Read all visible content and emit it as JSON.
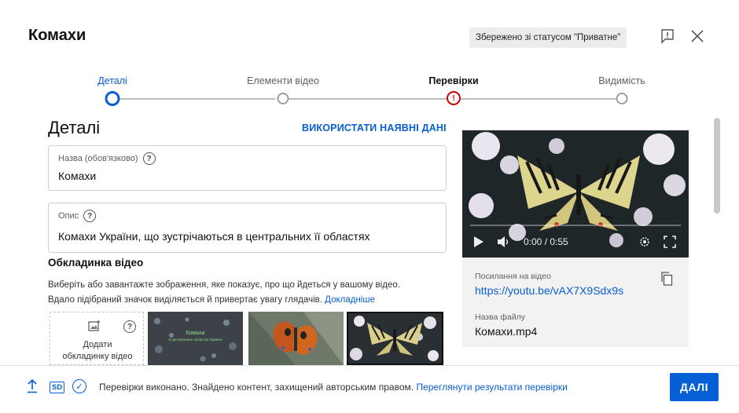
{
  "header": {
    "title": "Комахи",
    "save_status": "Збережено зі статусом \"Приватне\"",
    "feedback_icon": "feedback-icon",
    "close_icon": "close-icon"
  },
  "stepper": {
    "steps": [
      {
        "label": "Деталі",
        "state": "active"
      },
      {
        "label": "Елементи відео",
        "state": "pending"
      },
      {
        "label": "Перевірки",
        "state": "error"
      },
      {
        "label": "Видимість",
        "state": "pending"
      }
    ]
  },
  "details": {
    "heading": "Деталі",
    "reuse_link": "ВИКОРИСТАТИ НАЯВНІ ДАНІ",
    "name_label": "Назва (обов'язково)",
    "name_value": "Комахи",
    "desc_label": "Опис",
    "desc_value": "Комахи України, що зустрічаються в центральних її областях",
    "help_glyph": "?"
  },
  "thumbnail": {
    "heading": "Обкладинка відео",
    "desc_line1": "Виберіть або завантажте зображення, яке показує, про що йдеться у вашому відео.",
    "desc_line2": "Вдало підібраний значок виділяється й привертає увагу глядачів.",
    "learn_more": "Докладніше",
    "upload_label_line1": "Додати",
    "upload_label_line2": "обкладинку відео",
    "thumb1_text_line1": "Комахи",
    "thumb1_text_line2": "в центральних областях України"
  },
  "video": {
    "time": "0:00 / 0:55",
    "link_label": "Посилання на відео",
    "link": "https://youtu.be/vAX7X9Sdx9s",
    "file_label": "Назва файлу",
    "file_name": "Комахи.mp4"
  },
  "footer": {
    "sd_label": "SD",
    "status": "Перевірки виконано. Знайдено контент, захищений авторським правом.",
    "status_link": "Переглянути результати перевірки",
    "next_button": "ДАЛІ"
  },
  "colors": {
    "accent": "#065fd4",
    "error": "#cc0000"
  }
}
